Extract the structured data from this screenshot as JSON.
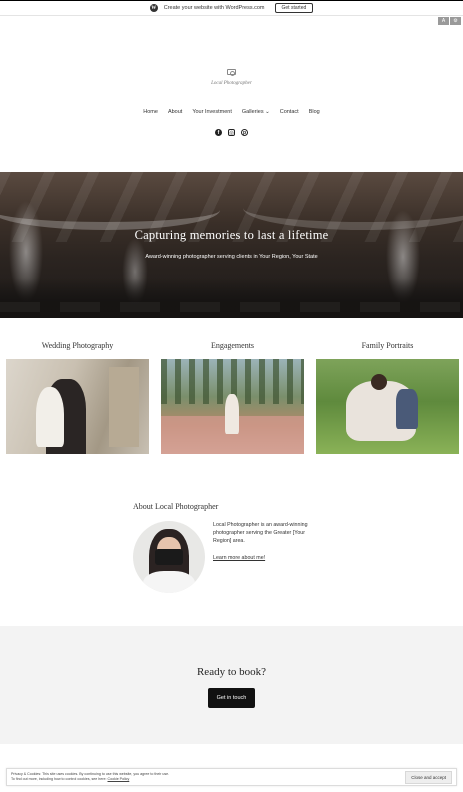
{
  "wp_bar": {
    "logo": "W",
    "text": "Create your website with WordPress.com",
    "button": "Get started"
  },
  "utility": {
    "a": "A",
    "b": "⚙"
  },
  "site": {
    "logo_text": "Local Photographer"
  },
  "nav": {
    "items": [
      "Home",
      "About",
      "Your Investment",
      "Galleries ⌄",
      "Contact",
      "Blog"
    ]
  },
  "social": {
    "facebook": "f",
    "instagram": "◎",
    "pinterest": "p"
  },
  "hero": {
    "title": "Capturing memories to last a lifetime",
    "subtitle": "Award-winning photographer serving clients in Your Region, Your State"
  },
  "services": [
    {
      "title": "Wedding Photography"
    },
    {
      "title": "Engagements"
    },
    {
      "title": "Family Portraits"
    }
  ],
  "about": {
    "heading": "About Local Photographer",
    "text": "Local Photographer is an award-winning photographer serving the Greater [Your Region] area.",
    "link": "Learn more about me!"
  },
  "cta": {
    "heading": "Ready to book?",
    "button": "Get in touch"
  },
  "cookie": {
    "line1": "Privacy & Cookies: This site uses cookies. By continuing to use this website, you agree to their use.",
    "line2": "To find out more, including how to control cookies, see here:",
    "policy": "Cookie Policy",
    "button": "Close and accept"
  }
}
